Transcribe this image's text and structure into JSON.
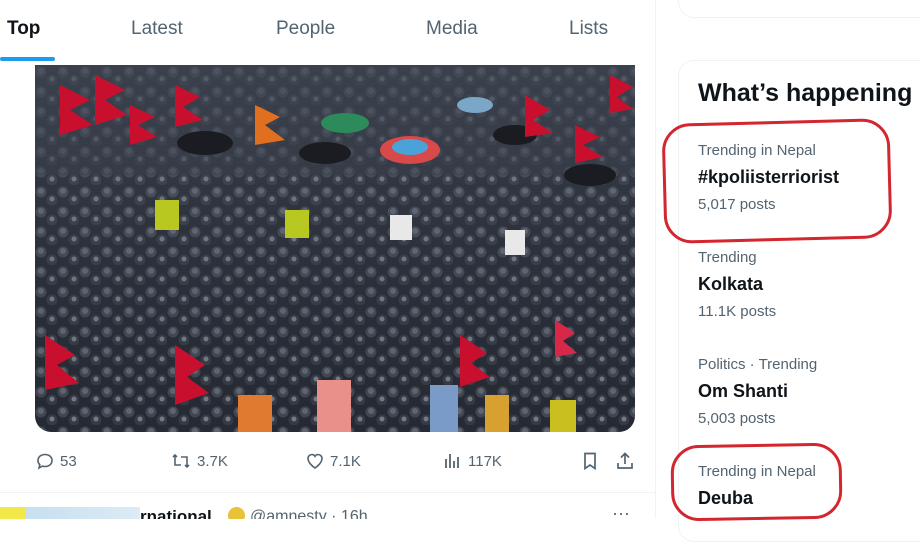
{
  "tabs": [
    {
      "label": "Top",
      "active": true
    },
    {
      "label": "Latest",
      "active": false
    },
    {
      "label": "People",
      "active": false
    },
    {
      "label": "Media",
      "active": false
    },
    {
      "label": "Lists",
      "active": false
    }
  ],
  "post": {
    "image_alt": "crowd of riot police with red flags and umbrellas",
    "actions": {
      "replies": "53",
      "reposts": "3.7K",
      "likes": "7.1K",
      "views": "117K"
    }
  },
  "next_post": {
    "name_fragment": "rnational",
    "handle_time": "@amnesty · 16h",
    "more": "···"
  },
  "sidebar": {
    "title": "What’s happening",
    "trends": [
      {
        "context": "Trending in Nepal",
        "name": "#kpoliisterriorist",
        "count": "5,017 posts",
        "highlighted": true
      },
      {
        "context": "Trending",
        "name": "Kolkata",
        "count": "11.1K posts",
        "highlighted": false
      },
      {
        "context": "Politics · Trending",
        "name": "Om Shanti",
        "count": "5,003 posts",
        "highlighted": false
      },
      {
        "context": "Trending in Nepal",
        "name": "Deuba",
        "count": "",
        "highlighted": true
      }
    ]
  },
  "colors": {
    "accent": "#1d9bf0",
    "highlight": "#d3262e",
    "muted_text": "#536471"
  }
}
